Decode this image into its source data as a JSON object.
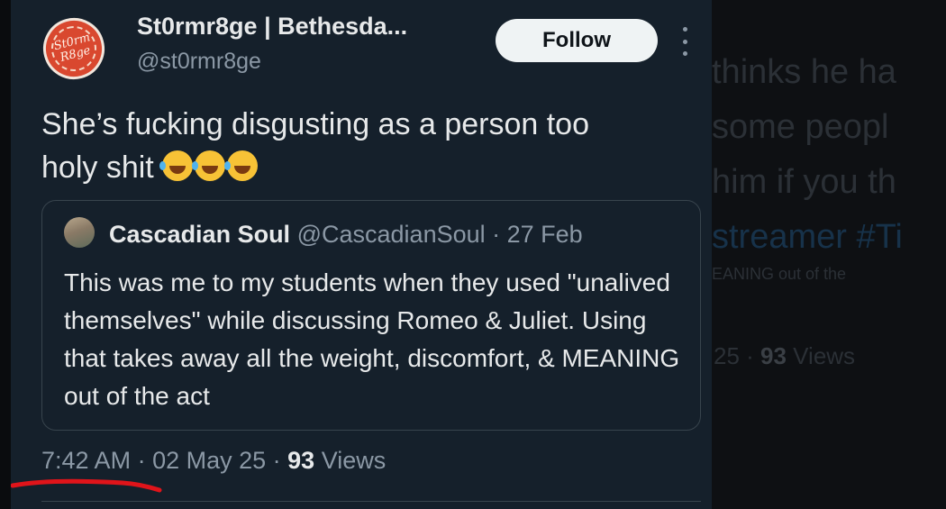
{
  "background": {
    "lines": [
      "thinks he ha",
      "some peopl",
      "him if you th"
    ],
    "hashtag_line": "streamer #Ti",
    "small_line": "EANING out of the",
    "views_prefix": "25 · ",
    "views_count": "93",
    "views_label": " Views"
  },
  "tweet": {
    "display_name": "St0rmr8ge | Bethesda...",
    "handle": "@st0rmr8ge",
    "follow_label": "Follow",
    "avatar_text": "St0rm R8ge",
    "text_line1": "She’s fucking disgusting as a person too",
    "text_line2": "holy shit",
    "emoji": "rolling-on-floor-laughing-icon",
    "emoji_count": 3,
    "time": "7:42 AM",
    "date": "02 May 25",
    "views_count": "93",
    "views_label": "Views"
  },
  "quoted": {
    "name": "Cascadian Soul",
    "handle": "@CascadianSoul",
    "date": "27 Feb",
    "text": "This was me to my students when they used \"unalived themselves\" while discussing Romeo & Juliet. Using that takes away all the weight, discomfort, & MEANING out of the act"
  },
  "colors": {
    "card_bg": "#15202b",
    "primary_text": "#e7e9ea",
    "secondary_text": "#8b98a5",
    "border": "#38444d",
    "follow_bg": "#eff3f4",
    "annotation_red": "#e0141a"
  }
}
